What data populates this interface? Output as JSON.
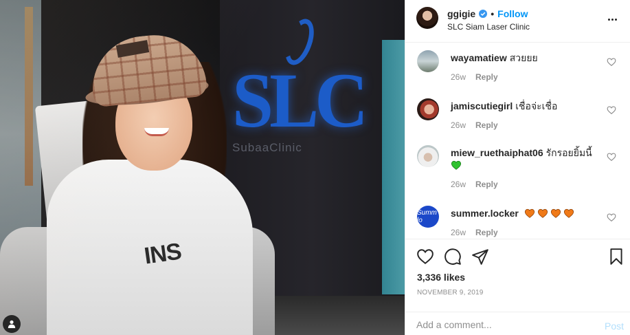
{
  "post": {
    "username": "ggigie",
    "follow_label": "Follow",
    "separator": "•",
    "location": "SLC Siam Laser Clinic",
    "photo_sign_text": "SLC",
    "photo_sign_subtext": "SubaaClinic",
    "photo_shirt_text": "INS"
  },
  "comments": [
    {
      "username": "wayamatiew",
      "text": "สวยยย",
      "time": "26w",
      "reply": "Reply",
      "emojis": []
    },
    {
      "username": "jamiscutiegirl",
      "text": "เชื่อจ่ะเชื่อ",
      "time": "26w",
      "reply": "Reply",
      "emojis": []
    },
    {
      "username": "miew_ruethaiphat06",
      "text": "รักรอยยิ้มนี้",
      "time": "26w",
      "reply": "Reply",
      "emojis": [
        "green-heart"
      ]
    },
    {
      "username": "summer.locker",
      "text": "",
      "time": "26w",
      "reply": "Reply",
      "emojis": [
        "orange-heart",
        "orange-heart",
        "orange-heart",
        "orange-heart"
      ]
    }
  ],
  "avatar_text": {
    "summer": "Summ lo"
  },
  "stats": {
    "likes": "3,336 likes",
    "date": "NOVEMBER 9, 2019"
  },
  "compose": {
    "placeholder": "Add a comment...",
    "post_label": "Post"
  },
  "colors": {
    "accent": "#0095f6",
    "post_disabled": "#b2dffc",
    "muted": "#8e8e8e",
    "green_heart": "#2fc22f",
    "orange_heart": "#f07a18"
  }
}
